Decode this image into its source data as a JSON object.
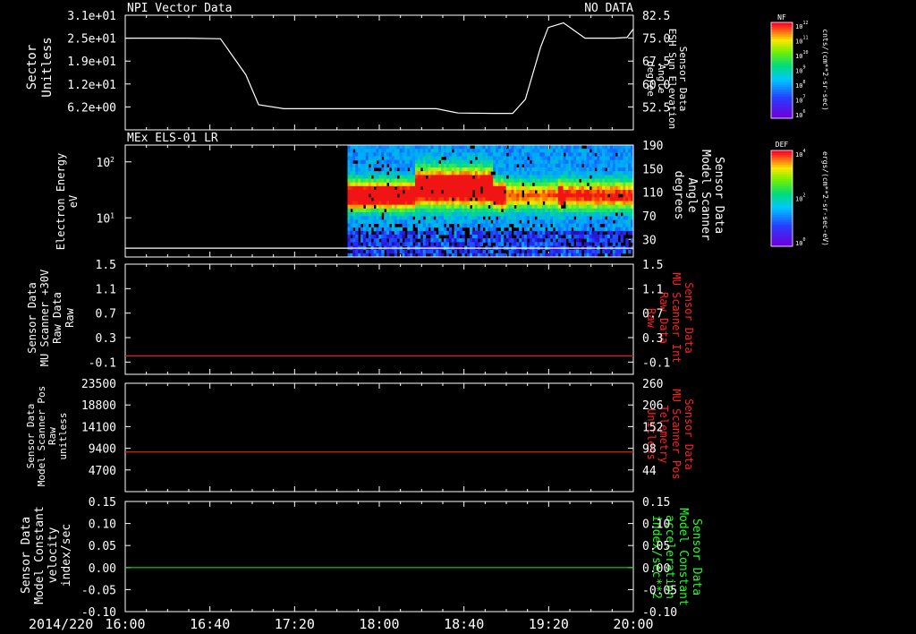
{
  "colors": {
    "background": "#000000",
    "axis": "#ffffff",
    "red_trace": "#e61e1e",
    "green_trace": "#19d219",
    "right_label_red": "#ff2020",
    "right_label_green": "#20ff20"
  },
  "footer": {
    "date": "2014/220",
    "time_ticks": [
      "16:00",
      "16:40",
      "17:20",
      "18:00",
      "18:40",
      "19:20",
      "20:00"
    ]
  },
  "chart_data": [
    {
      "type": "line",
      "panel": "sector",
      "title_left": "NPI Vector Data",
      "title_right": "NO DATA",
      "left_ylabel": [
        "Sector",
        "Unitless"
      ],
      "left_ticks": [
        "3.1e+01",
        "2.5e+01",
        "1.9e+01",
        "1.2e+01",
        "6.2e+00"
      ],
      "right_ylabel": [
        "Sensor Data",
        "ESH Sun Elevation",
        "Angle",
        "degree"
      ],
      "right_ticks": [
        "82.5",
        "75.0",
        "67.5",
        "60.0",
        "52.5"
      ],
      "right_ylim": [
        45,
        82.5
      ],
      "series": [
        {
          "x": [
            16.0,
            16.5,
            16.75,
            16.95,
            17.05,
            17.25,
            17.5,
            18.0,
            18.45,
            18.62,
            18.9,
            19.05,
            19.15,
            19.27,
            19.33,
            19.45,
            19.62,
            19.85,
            19.95,
            20.0
          ],
          "y": [
            75.0,
            75.0,
            74.8,
            63.0,
            53.2,
            51.9,
            51.9,
            51.9,
            51.9,
            50.5,
            50.4,
            50.4,
            55.0,
            72.0,
            78.5,
            80.0,
            75.0,
            75.0,
            75.2,
            78.0
          ]
        }
      ]
    },
    {
      "type": "heatmap",
      "panel": "spectrogram",
      "title_left": "MEx ELS-01 LR",
      "left_ylabel": [
        "Electron Energy",
        "eV"
      ],
      "left_ticks": [
        "10",
        "10",
        "10"
      ],
      "left_tick_exponents": [
        "2",
        "1",
        ""
      ],
      "right_ylabel": [
        "Sensor Data",
        "Model Scanner",
        "Angle",
        "degrees"
      ],
      "right_ticks": [
        "190",
        "150",
        "110",
        "70",
        "30"
      ],
      "right_ylim": [
        0,
        190
      ],
      "data_start_time": 17.75,
      "scanner_angle_line": 15
    },
    {
      "type": "line",
      "panel": "mu-scanner-int",
      "left_ylabel": [
        "Sensor Data",
        "MU Scanner +30V",
        "Raw Data",
        "Raw"
      ],
      "left_ticks": [
        "1.5",
        "1.1",
        "0.7",
        "0.3",
        "-0.1"
      ],
      "left_ylim": [
        -0.3,
        1.5
      ],
      "right_ylabel": [
        "Sensor Data",
        "MU Scanner Int",
        "Raw Data",
        "Raw"
      ],
      "right_ticks": [
        "1.5",
        "1.1",
        "0.7",
        "0.3",
        "-0.1"
      ],
      "series": [
        {
          "x": [
            16.0,
            20.0
          ],
          "y": [
            0.0,
            0.0
          ]
        }
      ]
    },
    {
      "type": "line",
      "panel": "mu-scanner-pos",
      "left_ylabel": [
        "Sensor Data",
        "Model Scanner Pos",
        "Raw",
        "unitless"
      ],
      "left_ticks": [
        "23500",
        "18800",
        "14100",
        "9400",
        "4700"
      ],
      "left_ylim": [
        0,
        23500
      ],
      "right_ylabel": [
        "Sensor Data",
        "MU Scanner Pos",
        "Telemetry",
        "Unitless"
      ],
      "right_ticks": [
        "260",
        "206",
        "152",
        "98",
        "44"
      ],
      "series": [
        {
          "x": [
            16.0,
            20.0
          ],
          "y": [
            8600,
            8600
          ]
        }
      ]
    },
    {
      "type": "line",
      "panel": "model-constant",
      "left_ylabel": [
        "Sensor Data",
        "Model Constant",
        "velocity",
        "index/sec"
      ],
      "left_ticks": [
        "0.15",
        "0.10",
        "0.05",
        "0.00",
        "-0.05",
        "-0.10"
      ],
      "left_ylim": [
        -0.1,
        0.15
      ],
      "right_ylabel": [
        "Sensor Data",
        "Model Constant",
        "acceleration",
        "index/sec**2"
      ],
      "right_ticks": [
        "0.15",
        "0.10",
        "0.05",
        "0.00",
        "-0.05",
        "-0.10"
      ],
      "series": [
        {
          "x": [
            16.0,
            20.0
          ],
          "y": [
            0.0,
            0.0
          ]
        }
      ]
    }
  ],
  "colorbars": [
    {
      "label": "NF",
      "unit": "cnts/(cm**2-sr-sec)",
      "ticks": [
        "10",
        "10",
        "10",
        "10",
        "10",
        "10",
        "10"
      ],
      "exponents": [
        "12",
        "11",
        "10",
        "9",
        "8",
        "7",
        "6"
      ]
    },
    {
      "label": "DEF",
      "unit": "ergs/(cm**2-sr-sec-eV)",
      "ticks": [
        "10",
        "10",
        "10"
      ],
      "exponents": [
        "4",
        "2",
        "0"
      ]
    }
  ]
}
